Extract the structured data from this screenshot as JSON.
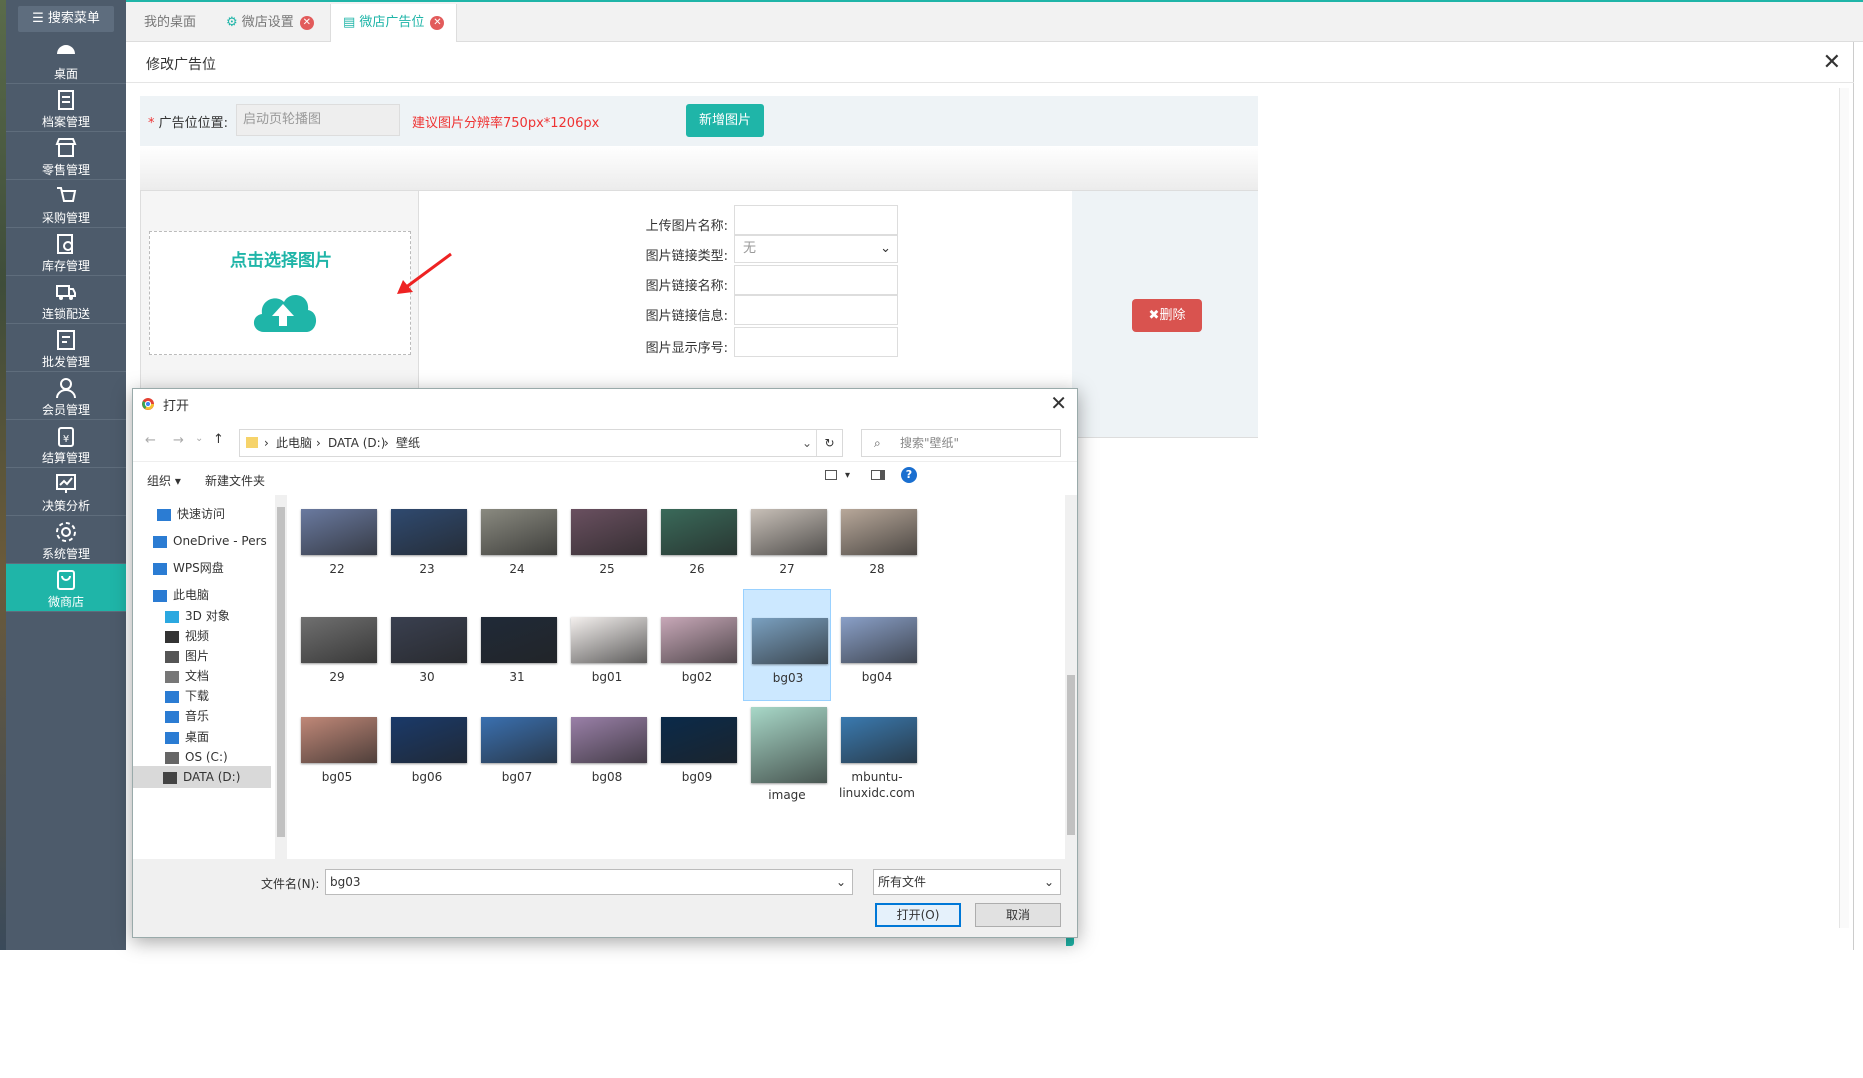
{
  "sidebar": {
    "search": "搜索菜单",
    "items": [
      {
        "label": "桌面",
        "icon": "dashboard-icon"
      },
      {
        "label": "档案管理",
        "icon": "archive-icon"
      },
      {
        "label": "零售管理",
        "icon": "store-icon"
      },
      {
        "label": "采购管理",
        "icon": "purchase-icon"
      },
      {
        "label": "库存管理",
        "icon": "inventory-icon"
      },
      {
        "label": "连锁配送",
        "icon": "truck-icon"
      },
      {
        "label": "批发管理",
        "icon": "wholesale-icon"
      },
      {
        "label": "会员管理",
        "icon": "member-icon"
      },
      {
        "label": "结算管理",
        "icon": "settlement-icon"
      },
      {
        "label": "决策分析",
        "icon": "analysis-icon"
      },
      {
        "label": "系统管理",
        "icon": "gear-icon"
      },
      {
        "label": "微商店",
        "icon": "shop-bag-icon"
      }
    ],
    "active": "微商店"
  },
  "tabs": [
    {
      "label": "我的桌面"
    },
    {
      "label": "微店设置",
      "closable": true
    },
    {
      "label": "微店广告位",
      "closable": true,
      "active": true
    }
  ],
  "panel": {
    "title": "修改广告位",
    "ad_position_label": "广告位位置:",
    "ad_position_value": "启动页轮播图",
    "tip": "建议图片分辨率750px*1206px",
    "add_button": "新增图片",
    "upload_prompt": "点击选择图片",
    "fields": [
      {
        "label": "上传图片名称:",
        "value": ""
      },
      {
        "label": "图片链接类型:",
        "value": "无"
      },
      {
        "label": "图片链接名称:",
        "value": ""
      },
      {
        "label": "图片链接信息:",
        "value": ""
      },
      {
        "label": "图片显示序号:",
        "value": ""
      }
    ],
    "delete_button": "删除"
  },
  "dialog": {
    "title": "打开",
    "path": [
      "此电脑",
      "DATA (D:)",
      "壁纸"
    ],
    "search_placeholder": "搜索\"壁纸\"",
    "organize": "组织",
    "new_folder": "新建文件夹",
    "tree": [
      {
        "label": "快速访问"
      },
      {
        "label": "OneDrive - Pers"
      },
      {
        "label": "WPS网盘"
      },
      {
        "label": "此电脑"
      },
      {
        "label": "3D 对象"
      },
      {
        "label": "视频"
      },
      {
        "label": "图片"
      },
      {
        "label": "文档"
      },
      {
        "label": "下载"
      },
      {
        "label": "音乐"
      },
      {
        "label": "桌面"
      },
      {
        "label": "OS (C:)"
      },
      {
        "label": "DATA (D:)",
        "selected": true
      }
    ],
    "files": [
      {
        "name": "22",
        "color": "#6a7aa0"
      },
      {
        "name": "23",
        "color": "#2f4a70"
      },
      {
        "name": "24",
        "color": "#8a8a80"
      },
      {
        "name": "25",
        "color": "#6a5060"
      },
      {
        "name": "26",
        "color": "#3a6a5a"
      },
      {
        "name": "27",
        "color": "#c8c0b8"
      },
      {
        "name": "28",
        "color": "#b8a89a"
      },
      {
        "name": "29",
        "color": "#707070"
      },
      {
        "name": "30",
        "color": "#3a4050"
      },
      {
        "name": "31",
        "color": "#202a38"
      },
      {
        "name": "bg01",
        "color": "#f4f0ee"
      },
      {
        "name": "bg02",
        "color": "#c8a8b8"
      },
      {
        "name": "bg03",
        "color": "#7aa0c0",
        "selected": true
      },
      {
        "name": "bg04",
        "color": "#8aa0c8"
      },
      {
        "name": "bg05",
        "color": "#c08878"
      },
      {
        "name": "bg06",
        "color": "#1a3a6a"
      },
      {
        "name": "bg07",
        "color": "#3a70b0"
      },
      {
        "name": "bg08",
        "color": "#9a80a8"
      },
      {
        "name": "bg09",
        "color": "#0a2a4a"
      },
      {
        "name": "image",
        "color": "#a8d8c8"
      },
      {
        "name": "mbuntu-linuxidc.com",
        "color": "#3a7ab0"
      }
    ],
    "filename_label": "文件名(N):",
    "filename": "bg03",
    "filetype": "所有文件",
    "open_button": "打开(O)",
    "cancel_button": "取消"
  }
}
